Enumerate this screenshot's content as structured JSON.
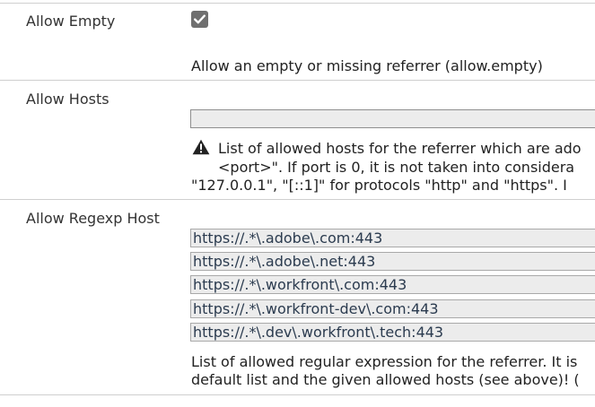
{
  "allow_empty": {
    "label": "Allow Empty",
    "checked": true,
    "description": "Allow an empty or missing referrer (allow.empty)"
  },
  "allow_hosts": {
    "label": "Allow Hosts",
    "value": "",
    "description_lines": [
      "List of allowed hosts for the referrer which are ado",
      "<port>\". If port is 0, it is not taken into considera",
      "\"127.0.0.1\", \"[::1]\" for protocols \"http\" and \"https\". I"
    ],
    "icon": "warning-icon"
  },
  "allow_regexp_host": {
    "label": "Allow Regexp Host",
    "values": [
      "https://.*\\.adobe\\.com:443",
      "https://.*\\.adobe\\.net:443",
      "https://.*\\.workfront\\.com:443",
      "https://.*\\.workfront-dev\\.com:443",
      "https://.*\\.dev\\.workfront\\.tech:443"
    ],
    "description_lines": [
      "List of allowed regular expression for the referrer. It is",
      "default list and the given allowed hosts (see above)! ("
    ]
  }
}
